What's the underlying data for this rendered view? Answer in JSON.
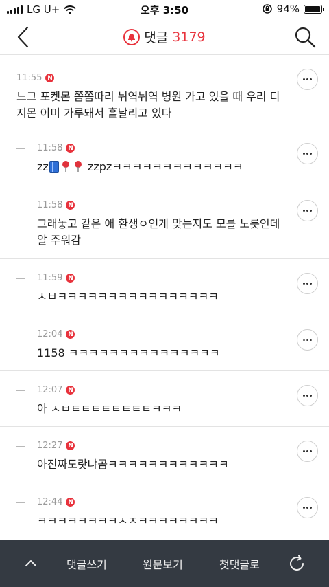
{
  "status_bar": {
    "carrier": "LG U+",
    "time": "오후 3:50",
    "battery": "94%",
    "battery_level": 0.94,
    "icons": [
      "signal-icon",
      "wifi-icon",
      "rotation-lock-icon",
      "battery-icon"
    ]
  },
  "header": {
    "title": "댓글",
    "count": "3179",
    "icons": [
      "back-icon",
      "bell-icon",
      "search-icon"
    ],
    "accent_color": "#e8323c"
  },
  "comments": [
    {
      "time": "11:55",
      "badge": "N",
      "reply": false,
      "text": "느그 포켓몬 쫌쫌따리 뉘역뉘역 병원 가고 있을 때 우리 디지몬 이미 가루돼서 흩날리고 있다"
    },
    {
      "time": "11:58",
      "badge": "N",
      "reply": true,
      "text_parts": [
        "zz",
        "",
        "zzpzㅋㅋㅋㅋㅋㅋㅋㅋㅋㅋㅋㅋㅋ"
      ],
      "emoji": [
        "blue-book-emoji",
        "round-pushpin-emoji",
        "round-pushpin-emoji"
      ]
    },
    {
      "time": "11:58",
      "badge": "N",
      "reply": true,
      "text": "그래놓고 같은 애 환생ㅇ인게 맞는지도 모를 노릇인데 알 주워감"
    },
    {
      "time": "11:59",
      "badge": "N",
      "reply": true,
      "text": "ㅅㅂㅋㅋㅋㅋㅋㅋㅋㅋㅋㅋㅋㅋㅋㅋㅋㅋ"
    },
    {
      "time": "12:04",
      "badge": "N",
      "reply": true,
      "text": "1158 ㅋㅋㅋㅋㅋㅋㅋㅋㅋㅋㅋㅋㅋㅋㅋ"
    },
    {
      "time": "12:07",
      "badge": "N",
      "reply": true,
      "text": "아 ㅅㅂㅌㅌㅌㅌㅌㅌㅌㅌㅋㅋㅋ"
    },
    {
      "time": "12:27",
      "badge": "N",
      "reply": true,
      "text": "아진짜도랏냐곰ㅋㅋㅋㅋㅋㅋㅋㅋㅋㅋㅋㅋ"
    },
    {
      "time": "12:44",
      "badge": "N",
      "reply": true,
      "text": "ㅋㅋㅋㅋㅋㅋㅋㅋㅅㅈㅋㅋㅋㅋㅋㅋㅋㅋ"
    }
  ],
  "bottom_bar": {
    "write_comment": "댓글쓰기",
    "view_original": "원문보기",
    "first_comment": "첫댓글로",
    "icons": [
      "chevron-up-icon",
      "refresh-icon"
    ]
  }
}
